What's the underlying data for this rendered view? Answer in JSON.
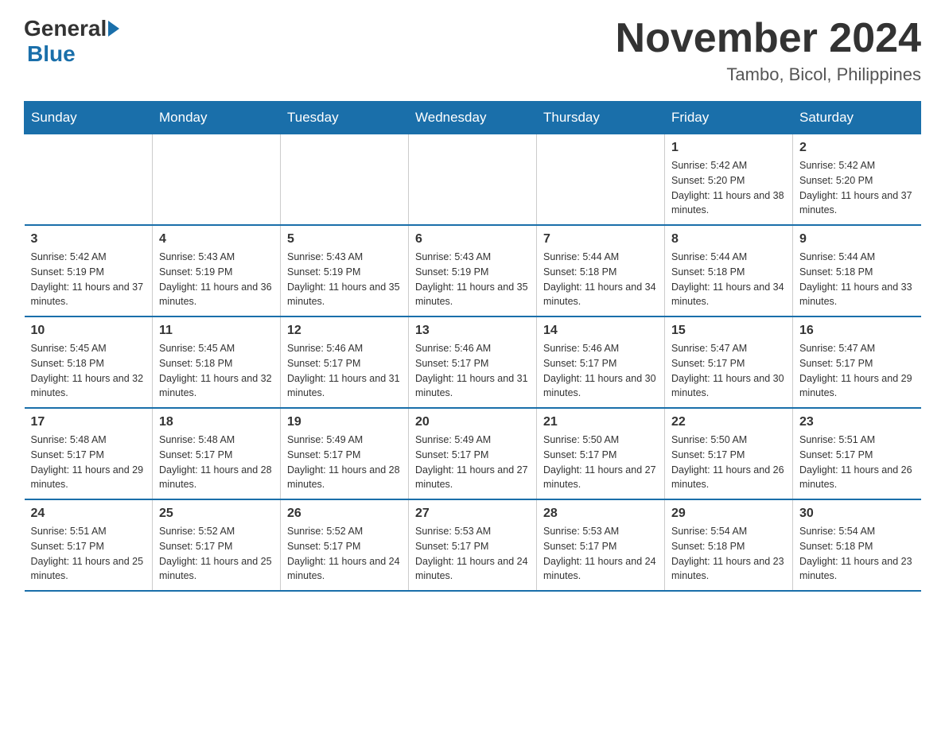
{
  "logo": {
    "general": "General",
    "blue": "Blue"
  },
  "title": "November 2024",
  "subtitle": "Tambo, Bicol, Philippines",
  "days_of_week": [
    "Sunday",
    "Monday",
    "Tuesday",
    "Wednesday",
    "Thursday",
    "Friday",
    "Saturday"
  ],
  "weeks": [
    [
      {
        "day": "",
        "sunrise": "",
        "sunset": "",
        "daylight": ""
      },
      {
        "day": "",
        "sunrise": "",
        "sunset": "",
        "daylight": ""
      },
      {
        "day": "",
        "sunrise": "",
        "sunset": "",
        "daylight": ""
      },
      {
        "day": "",
        "sunrise": "",
        "sunset": "",
        "daylight": ""
      },
      {
        "day": "",
        "sunrise": "",
        "sunset": "",
        "daylight": ""
      },
      {
        "day": "1",
        "sunrise": "Sunrise: 5:42 AM",
        "sunset": "Sunset: 5:20 PM",
        "daylight": "Daylight: 11 hours and 38 minutes."
      },
      {
        "day": "2",
        "sunrise": "Sunrise: 5:42 AM",
        "sunset": "Sunset: 5:20 PM",
        "daylight": "Daylight: 11 hours and 37 minutes."
      }
    ],
    [
      {
        "day": "3",
        "sunrise": "Sunrise: 5:42 AM",
        "sunset": "Sunset: 5:19 PM",
        "daylight": "Daylight: 11 hours and 37 minutes."
      },
      {
        "day": "4",
        "sunrise": "Sunrise: 5:43 AM",
        "sunset": "Sunset: 5:19 PM",
        "daylight": "Daylight: 11 hours and 36 minutes."
      },
      {
        "day": "5",
        "sunrise": "Sunrise: 5:43 AM",
        "sunset": "Sunset: 5:19 PM",
        "daylight": "Daylight: 11 hours and 35 minutes."
      },
      {
        "day": "6",
        "sunrise": "Sunrise: 5:43 AM",
        "sunset": "Sunset: 5:19 PM",
        "daylight": "Daylight: 11 hours and 35 minutes."
      },
      {
        "day": "7",
        "sunrise": "Sunrise: 5:44 AM",
        "sunset": "Sunset: 5:18 PM",
        "daylight": "Daylight: 11 hours and 34 minutes."
      },
      {
        "day": "8",
        "sunrise": "Sunrise: 5:44 AM",
        "sunset": "Sunset: 5:18 PM",
        "daylight": "Daylight: 11 hours and 34 minutes."
      },
      {
        "day": "9",
        "sunrise": "Sunrise: 5:44 AM",
        "sunset": "Sunset: 5:18 PM",
        "daylight": "Daylight: 11 hours and 33 minutes."
      }
    ],
    [
      {
        "day": "10",
        "sunrise": "Sunrise: 5:45 AM",
        "sunset": "Sunset: 5:18 PM",
        "daylight": "Daylight: 11 hours and 32 minutes."
      },
      {
        "day": "11",
        "sunrise": "Sunrise: 5:45 AM",
        "sunset": "Sunset: 5:18 PM",
        "daylight": "Daylight: 11 hours and 32 minutes."
      },
      {
        "day": "12",
        "sunrise": "Sunrise: 5:46 AM",
        "sunset": "Sunset: 5:17 PM",
        "daylight": "Daylight: 11 hours and 31 minutes."
      },
      {
        "day": "13",
        "sunrise": "Sunrise: 5:46 AM",
        "sunset": "Sunset: 5:17 PM",
        "daylight": "Daylight: 11 hours and 31 minutes."
      },
      {
        "day": "14",
        "sunrise": "Sunrise: 5:46 AM",
        "sunset": "Sunset: 5:17 PM",
        "daylight": "Daylight: 11 hours and 30 minutes."
      },
      {
        "day": "15",
        "sunrise": "Sunrise: 5:47 AM",
        "sunset": "Sunset: 5:17 PM",
        "daylight": "Daylight: 11 hours and 30 minutes."
      },
      {
        "day": "16",
        "sunrise": "Sunrise: 5:47 AM",
        "sunset": "Sunset: 5:17 PM",
        "daylight": "Daylight: 11 hours and 29 minutes."
      }
    ],
    [
      {
        "day": "17",
        "sunrise": "Sunrise: 5:48 AM",
        "sunset": "Sunset: 5:17 PM",
        "daylight": "Daylight: 11 hours and 29 minutes."
      },
      {
        "day": "18",
        "sunrise": "Sunrise: 5:48 AM",
        "sunset": "Sunset: 5:17 PM",
        "daylight": "Daylight: 11 hours and 28 minutes."
      },
      {
        "day": "19",
        "sunrise": "Sunrise: 5:49 AM",
        "sunset": "Sunset: 5:17 PM",
        "daylight": "Daylight: 11 hours and 28 minutes."
      },
      {
        "day": "20",
        "sunrise": "Sunrise: 5:49 AM",
        "sunset": "Sunset: 5:17 PM",
        "daylight": "Daylight: 11 hours and 27 minutes."
      },
      {
        "day": "21",
        "sunrise": "Sunrise: 5:50 AM",
        "sunset": "Sunset: 5:17 PM",
        "daylight": "Daylight: 11 hours and 27 minutes."
      },
      {
        "day": "22",
        "sunrise": "Sunrise: 5:50 AM",
        "sunset": "Sunset: 5:17 PM",
        "daylight": "Daylight: 11 hours and 26 minutes."
      },
      {
        "day": "23",
        "sunrise": "Sunrise: 5:51 AM",
        "sunset": "Sunset: 5:17 PM",
        "daylight": "Daylight: 11 hours and 26 minutes."
      }
    ],
    [
      {
        "day": "24",
        "sunrise": "Sunrise: 5:51 AM",
        "sunset": "Sunset: 5:17 PM",
        "daylight": "Daylight: 11 hours and 25 minutes."
      },
      {
        "day": "25",
        "sunrise": "Sunrise: 5:52 AM",
        "sunset": "Sunset: 5:17 PM",
        "daylight": "Daylight: 11 hours and 25 minutes."
      },
      {
        "day": "26",
        "sunrise": "Sunrise: 5:52 AM",
        "sunset": "Sunset: 5:17 PM",
        "daylight": "Daylight: 11 hours and 24 minutes."
      },
      {
        "day": "27",
        "sunrise": "Sunrise: 5:53 AM",
        "sunset": "Sunset: 5:17 PM",
        "daylight": "Daylight: 11 hours and 24 minutes."
      },
      {
        "day": "28",
        "sunrise": "Sunrise: 5:53 AM",
        "sunset": "Sunset: 5:17 PM",
        "daylight": "Daylight: 11 hours and 24 minutes."
      },
      {
        "day": "29",
        "sunrise": "Sunrise: 5:54 AM",
        "sunset": "Sunset: 5:18 PM",
        "daylight": "Daylight: 11 hours and 23 minutes."
      },
      {
        "day": "30",
        "sunrise": "Sunrise: 5:54 AM",
        "sunset": "Sunset: 5:18 PM",
        "daylight": "Daylight: 11 hours and 23 minutes."
      }
    ]
  ]
}
